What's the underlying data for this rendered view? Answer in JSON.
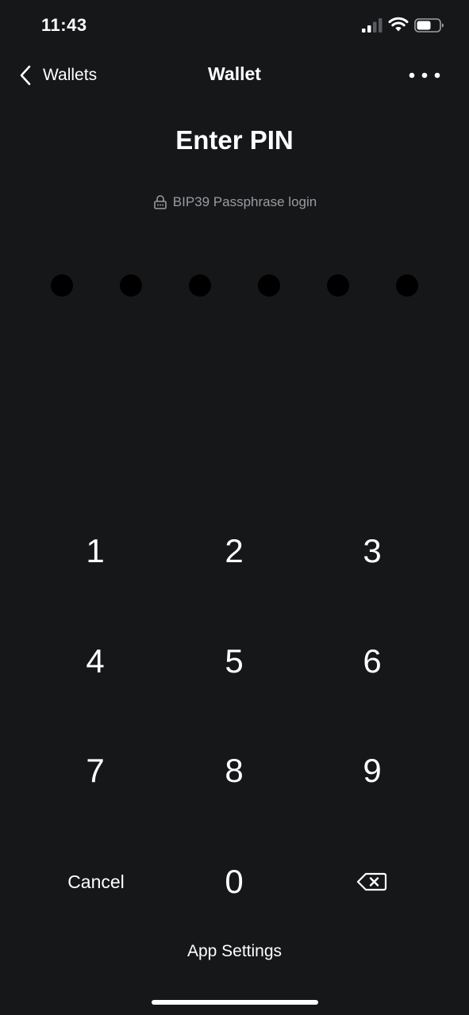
{
  "status_bar": {
    "time": "11:43",
    "signal_icon": "cellular-signal-icon",
    "wifi_icon": "wifi-icon",
    "battery_icon": "battery-icon"
  },
  "nav": {
    "back_label": "Wallets",
    "back_icon": "chevron-left-icon",
    "title": "Wallet",
    "more_icon": "more-horizontal-icon"
  },
  "pin": {
    "title": "Enter PIN",
    "passphrase_label": "BIP39 Passphrase login",
    "passphrase_icon": "lock-icon",
    "digit_count": 6,
    "entered": 0
  },
  "keypad": {
    "keys": [
      "1",
      "2",
      "3",
      "4",
      "5",
      "6",
      "7",
      "8",
      "9"
    ],
    "cancel_label": "Cancel",
    "zero_label": "0",
    "backspace_icon": "backspace-icon"
  },
  "footer": {
    "settings_label": "App Settings"
  },
  "colors": {
    "background": "#161719",
    "text": "#ffffff",
    "muted": "#9a9ba0",
    "pin_dot": "#000000"
  }
}
